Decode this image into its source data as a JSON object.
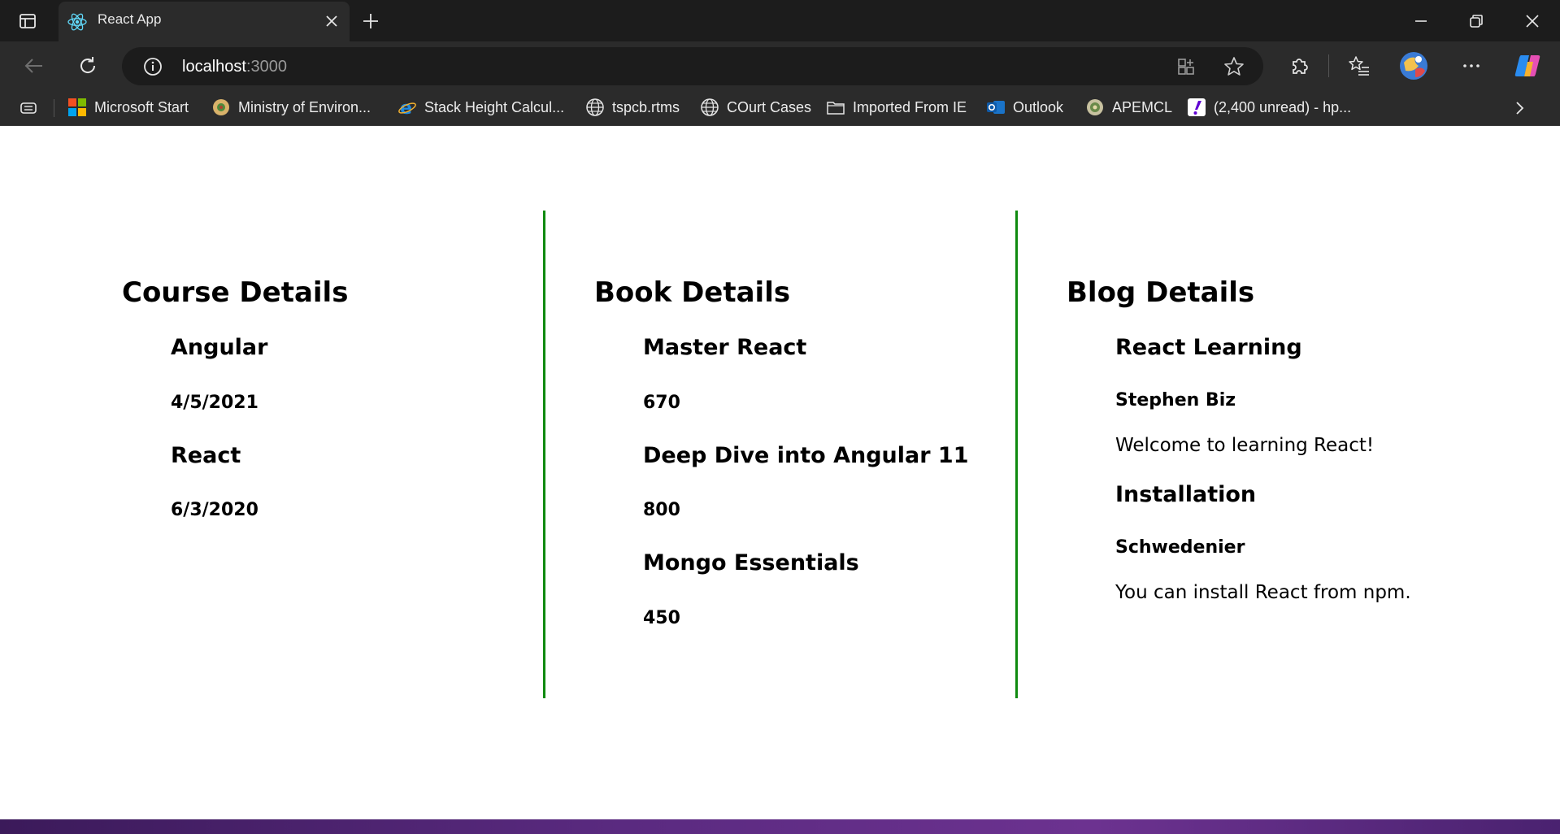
{
  "browser": {
    "tab": {
      "title": "React App"
    },
    "address": {
      "host": "localhost",
      "port": ":3000"
    },
    "bookmarks": [
      {
        "label": "Microsoft Start",
        "icon": "microsoft-logo-icon"
      },
      {
        "label": "Ministry of Environ...",
        "icon": "emblem-icon"
      },
      {
        "label": "Stack Height Calcul...",
        "icon": "internet-explorer-icon"
      },
      {
        "label": "tspcb.rtms",
        "icon": "globe-icon"
      },
      {
        "label": "COurt Cases",
        "icon": "globe-icon"
      },
      {
        "label": "Imported From IE",
        "icon": "folder-icon"
      },
      {
        "label": "Outlook",
        "icon": "outlook-icon"
      },
      {
        "label": "APEMCL",
        "icon": "seal-icon"
      },
      {
        "label": "(2,400 unread) - hp...",
        "icon": "yahoo-mail-icon"
      }
    ]
  },
  "courses": {
    "title": "Course Details",
    "items": [
      {
        "name": "Angular",
        "date": "4/5/2021"
      },
      {
        "name": "React",
        "date": "6/3/2020"
      }
    ]
  },
  "books": {
    "title": "Book Details",
    "items": [
      {
        "name": "Master React",
        "price": "670"
      },
      {
        "name": "Deep Dive into Angular 11",
        "price": "800"
      },
      {
        "name": "Mongo Essentials",
        "price": "450"
      }
    ]
  },
  "blogs": {
    "title": "Blog Details",
    "items": [
      {
        "title": "React Learning",
        "author": "Stephen Biz",
        "content": "Welcome to learning React!"
      },
      {
        "title": "Installation",
        "author": "Schwedenier",
        "content": "You can install React from npm."
      }
    ]
  },
  "colors": {
    "divider": "#0f8a0f",
    "chrome_dark": "#1c1c1c",
    "chrome": "#2b2b2b"
  }
}
